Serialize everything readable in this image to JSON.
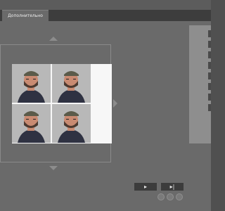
{
  "tabs": [
    {
      "label": "Дополнительно"
    }
  ],
  "navigation": {
    "up_icon": "triangle-up-icon",
    "down_icon": "triangle-down-icon",
    "right_icon": "triangle-right-icon"
  },
  "preview": {
    "photos": [
      {
        "name": "photo-1"
      },
      {
        "name": "photo-2"
      },
      {
        "name": "photo-3"
      },
      {
        "name": "photo-4"
      }
    ]
  },
  "controls": {
    "play_label": "▸",
    "next_label": "▸|",
    "icons": [
      "rotate-left-icon",
      "refresh-icon",
      "rotate-right-icon"
    ]
  },
  "colors": {
    "background": "#505050",
    "pane": "#6a6a6a",
    "sheet": "#f7f7f7",
    "button": "#3c3c3c"
  }
}
